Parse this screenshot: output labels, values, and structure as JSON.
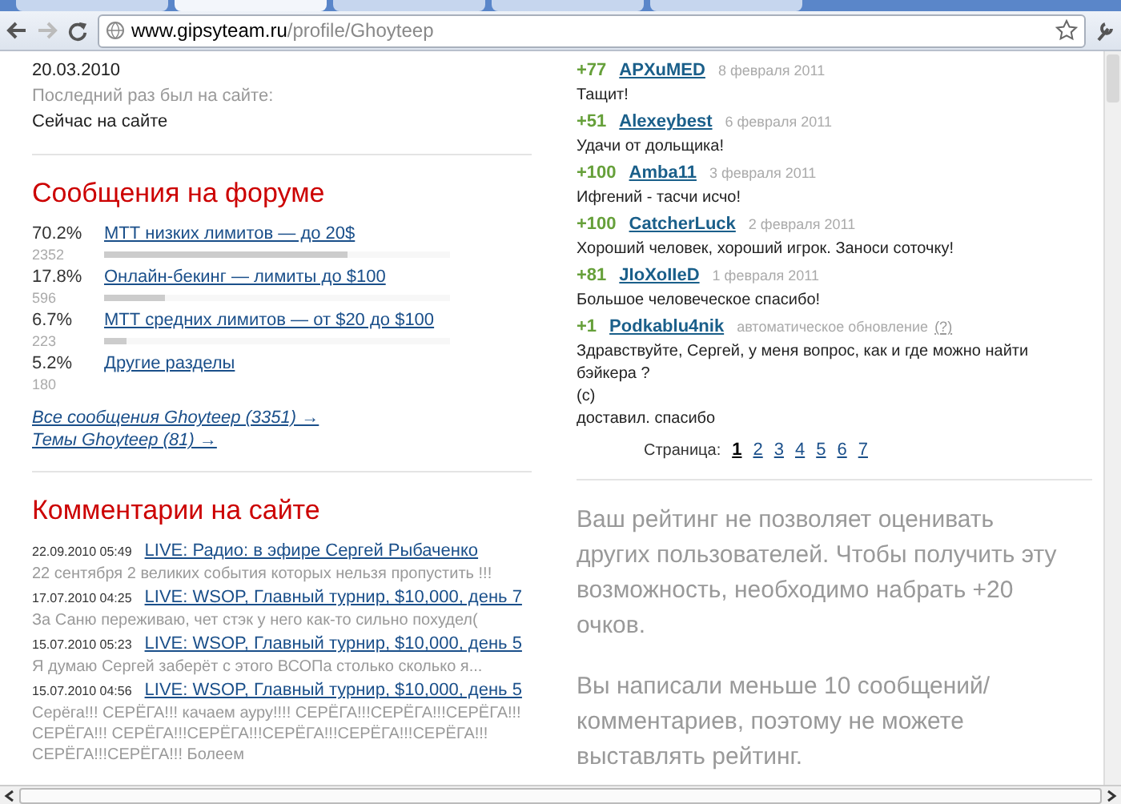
{
  "browser": {
    "tabs": [
      {
        "selected": false
      },
      {
        "selected": true
      },
      {
        "selected": false
      },
      {
        "selected": false
      },
      {
        "selected": false
      }
    ],
    "url_host": "www.gipsyteam.ru",
    "url_path": "/profile/Ghoyteep"
  },
  "profile": {
    "registered": "20.03.2010",
    "last_seen_label": "Последний раз был на сайте:",
    "last_seen": "Сейчас на сайте"
  },
  "forum": {
    "title": "Сообщения на форуме",
    "sections": [
      {
        "percent": "70.2%",
        "name": "МТТ низких лимитов — до 20$",
        "count": "2352",
        "level": 0.702
      },
      {
        "percent": "17.8%",
        "name": "Онлайн-бекинг — лимиты до $100",
        "count": "596",
        "level": 0.178
      },
      {
        "percent": "6.7%",
        "name": "МТТ средних лимитов — от $20 до $100",
        "count": "223",
        "level": 0.067
      },
      {
        "percent": "5.2%",
        "name": "Другие разделы",
        "count": "180"
      }
    ],
    "links": [
      "Все сообщения Ghoyteep (3351) →",
      "Темы Ghoyteep (81) →"
    ]
  },
  "comments": {
    "title": "Комментарии на сайте",
    "items": [
      {
        "date": "22.09.2010 05:49",
        "topic": "LIVE: Радио: в эфире Сергей Рыбаченко",
        "text": "22 сентября 2 великих события которых нельзя пропустить !!!"
      },
      {
        "date": "17.07.2010 04:25",
        "topic": "LIVE: WSOP, Главный турнир, $10,000, день 7",
        "text": "За Саню переживаю, чет стэк у него как-то сильно похудел("
      },
      {
        "date": "15.07.2010 05:23",
        "topic": "LIVE: WSOP, Главный турнир, $10,000, день 5",
        "text": "Я думаю Сергей заберёт с этого ВСОПа столько сколько я..."
      },
      {
        "date": "15.07.2010 04:56",
        "topic": "LIVE: WSOP, Главный турнир, $10,000, день 5",
        "text": "Серёга!!! СЕРЁГА!!! качаем ауру!!!! СЕРЁГА!!!СЕРЁГА!!!СЕРЁГА!!!СЕРЁГА!!! СЕРЁГА!!!СЕРЁГА!!!СЕРЁГА!!!СЕРЁГА!!!СЕРЁГА!!!СЕРЁГА!!!СЕРЁГА!!! Болеем"
      }
    ]
  },
  "ratings": [
    {
      "score": "+77",
      "user": "APXuMED",
      "date": "8 февраля 2011",
      "text": "Тащит!"
    },
    {
      "score": "+51",
      "user": "Alexeybest",
      "date": "6 февраля 2011",
      "text": "Удачи от дольщика!"
    },
    {
      "score": "+100",
      "user": "Amba11",
      "date": "3 февраля 2011",
      "text": "Ифгений - тасчи исчо!"
    },
    {
      "score": "+100",
      "user": "CatcherLuck",
      "date": "2 февраля 2011",
      "text": "Хороший человек, хороший игрок. Заноси соточку!"
    },
    {
      "score": "+81",
      "user": "JIoXoIIeD",
      "date": "1 февраля 2011",
      "text": "Большое человеческое спасибо!"
    },
    {
      "score": "+1",
      "user": "Podkablu4nik",
      "date": "автоматическое обновление",
      "help": "(?)",
      "text": "Здравствуйте, Сергей, у меня вопрос, как и где можно найти бэйкера ?\n(с)\nдоставил. спасибо"
    }
  ],
  "pagination": {
    "label": "Страница:",
    "pages": [
      {
        "label": "1",
        "selected": true
      },
      {
        "label": "2",
        "selected": false
      },
      {
        "label": "3",
        "selected": false
      },
      {
        "label": "4",
        "selected": false
      },
      {
        "label": "5",
        "selected": false
      },
      {
        "label": "6",
        "selected": false
      },
      {
        "label": "7",
        "selected": false
      }
    ]
  },
  "notices": [
    "Ваш рейтинг не позволяет оценивать других пользователей. Чтобы получить эту возможность, необходимо набрать +20 очков.",
    "Вы написали меньше 10 сообщений/комментариев, поэтому не можете выставлять рейтинг."
  ]
}
